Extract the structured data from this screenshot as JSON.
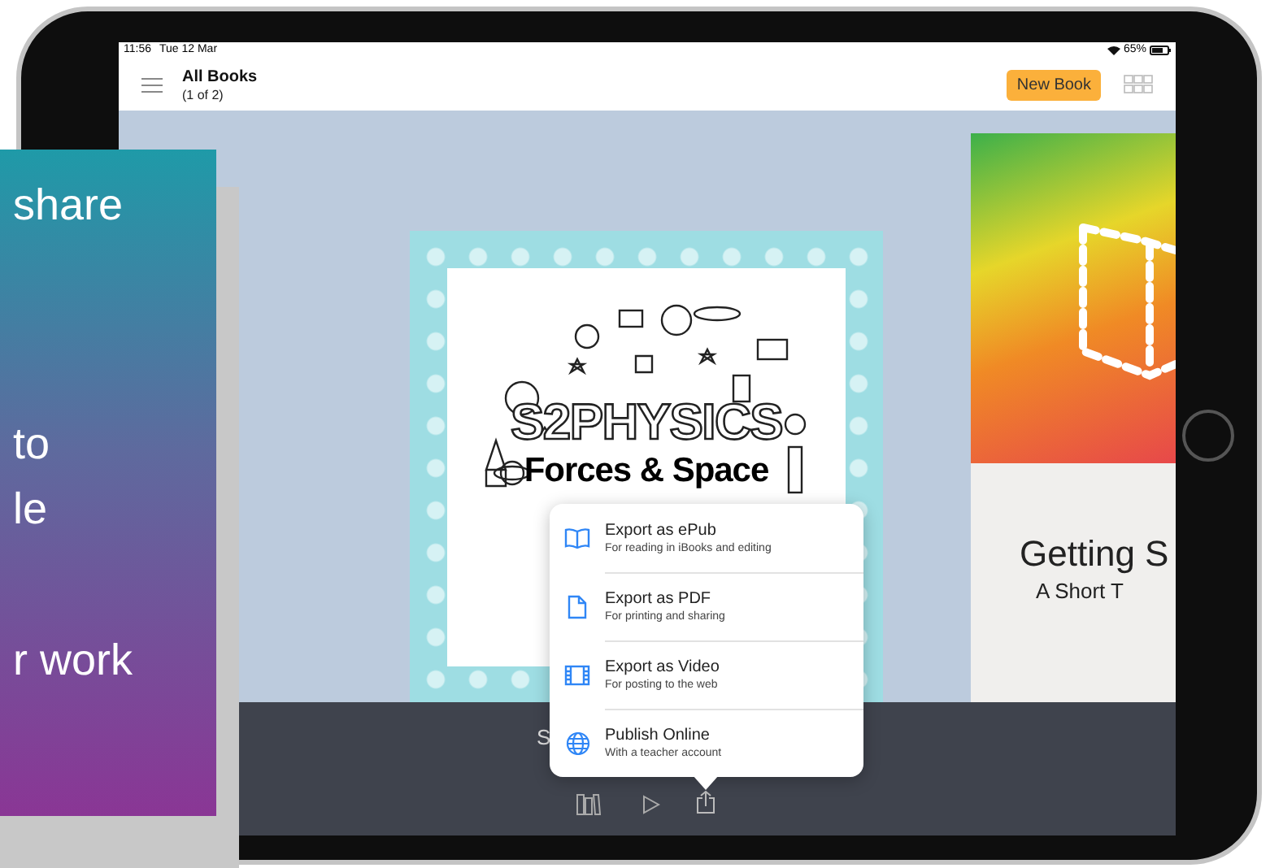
{
  "slide_overlay": {
    "lines": [
      "share",
      "to",
      "le",
      "r work"
    ]
  },
  "status_bar": {
    "time": "11:56",
    "date": "Tue 12 Mar",
    "battery": "65%"
  },
  "nav_bar": {
    "title": "All Books",
    "subtitle": "(1 of 2)",
    "new_book_button": "New Book"
  },
  "books": [
    {
      "kind": "doodle",
      "title": "S2PHYSICS",
      "subtitle": "Forces & Space"
    },
    {
      "kind": "gradient",
      "title": "Getting S",
      "subtitle": "A Short T"
    }
  ],
  "book_caption": "S",
  "share_menu": {
    "items": [
      {
        "kind": "epub",
        "label": "Export as ePub",
        "detail": "For reading in iBooks and editing"
      },
      {
        "kind": "pdf",
        "label": "Export as PDF",
        "detail": "For printing and sharing"
      },
      {
        "kind": "video",
        "label": "Export as Video",
        "detail": "For posting to the web"
      },
      {
        "kind": "web",
        "label": "Publish Online",
        "detail": "With a teacher account"
      }
    ]
  }
}
